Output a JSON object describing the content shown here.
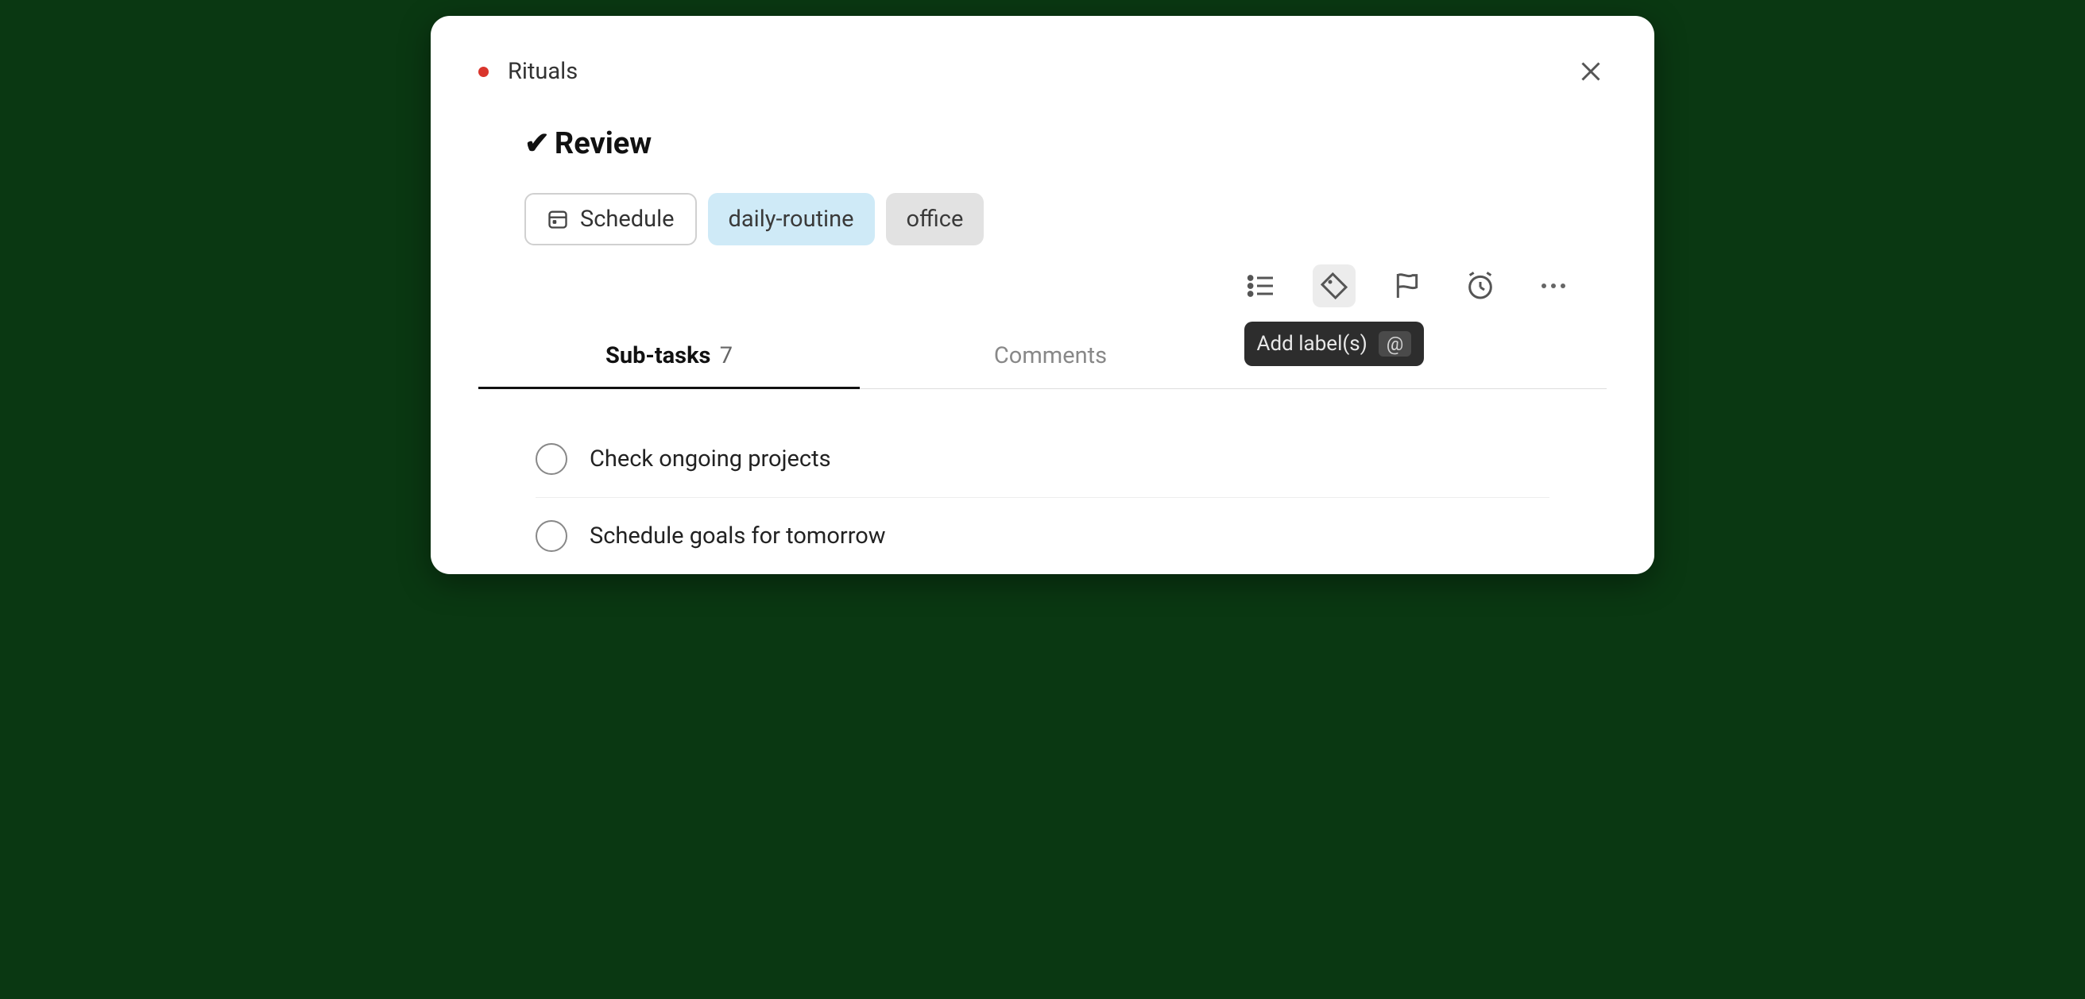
{
  "project": {
    "name": "Rituals",
    "dot_color": "#d9352c"
  },
  "task": {
    "checkmark": "✔",
    "title": "Review"
  },
  "chips": {
    "schedule_label": "Schedule",
    "tag1": "daily-routine",
    "tag2": "office"
  },
  "toolbar": {
    "tooltip_text": "Add label(s)",
    "tooltip_key": "@"
  },
  "tabs": {
    "subtasks_label": "Sub-tasks",
    "subtasks_count": "7",
    "comments_label": "Comments"
  },
  "subtasks": [
    {
      "text": "Check ongoing projects"
    },
    {
      "text": "Schedule goals for tomorrow"
    }
  ]
}
